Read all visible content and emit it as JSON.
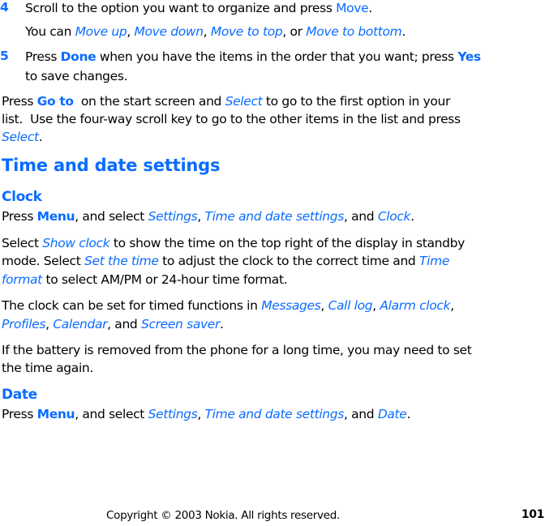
{
  "steps": [
    {
      "number": "4",
      "text_1": "Scroll to the option you want to organize and press ",
      "key": "Move",
      "text_2": ".",
      "sub": {
        "text_1": "You can ",
        "opt_1": "Move up",
        "sep_1": ", ",
        "opt_2": "Move down",
        "sep_2": ", ",
        "opt_3": "Move to top",
        "sep_3": ", or ",
        "opt_4": "Move to bottom",
        "end": "."
      }
    },
    {
      "number": "5",
      "text_1": "Press ",
      "key_1": "Done",
      "text_2": " when you have the items in the order that you want; press ",
      "key_2": "Yes",
      "text_3": "to save changes."
    }
  ],
  "goto_para": {
    "l1_text_1": "Press ",
    "l1_key": "Go to",
    "l1_text_2": "  on the start screen and ",
    "l1_opt": "Select",
    "l1_text_3": " to go to the first option in your",
    "l2_text": "list.  Use the four-way scroll key to go to the other items in the list and press",
    "l3_opt": "Select",
    "l3_end": "."
  },
  "section_title": "Time and date settings",
  "clock": {
    "heading": "Clock",
    "menu_line": {
      "t1": "Press ",
      "key": "Menu",
      "t2": ", and select ",
      "o1": "Settings",
      "s1": ", ",
      "o2": "Time and date settings",
      "s2": ", and ",
      "o3": "Clock",
      "end": "."
    },
    "show_clock_para": {
      "l1_t1": "Select ",
      "l1_opt": "Show clock",
      "l1_t2": " to show the time on the top right of the display in standby",
      "l2_t1": "mode. Select ",
      "l2_opt": "Set the time",
      "l2_t2": " to adjust the clock to the correct time and ",
      "l2_opt2": "Time",
      "l3_opt": "format",
      "l3_t": " to select AM/PM or 24-hour time format."
    },
    "timed_para": {
      "l1_t": "The clock can be set for timed functions in ",
      "o1": "Messages",
      "s1": ", ",
      "o2": "Call log",
      "s2": ", ",
      "o3": "Alarm clock",
      "s3": ",",
      "o4": "Profiles",
      "s4": ", ",
      "o5": "Calendar",
      "s5": ", and ",
      "o6": "Screen saver",
      "end": "."
    },
    "battery_para": {
      "l1": "If the battery is removed from the phone for a long time, you may need to set",
      "l2": "the time again."
    }
  },
  "date": {
    "heading": "Date",
    "menu_line": {
      "t1": "Press ",
      "key": "Menu",
      "t2": ", and select ",
      "o1": "Settings",
      "s1": ", ",
      "o2": "Time and date settings",
      "s2": ", and ",
      "o3": "Date",
      "end": "."
    }
  },
  "footer": {
    "copyright": "Copyright © 2003 Nokia. All rights reserved.",
    "page_number": "101"
  }
}
